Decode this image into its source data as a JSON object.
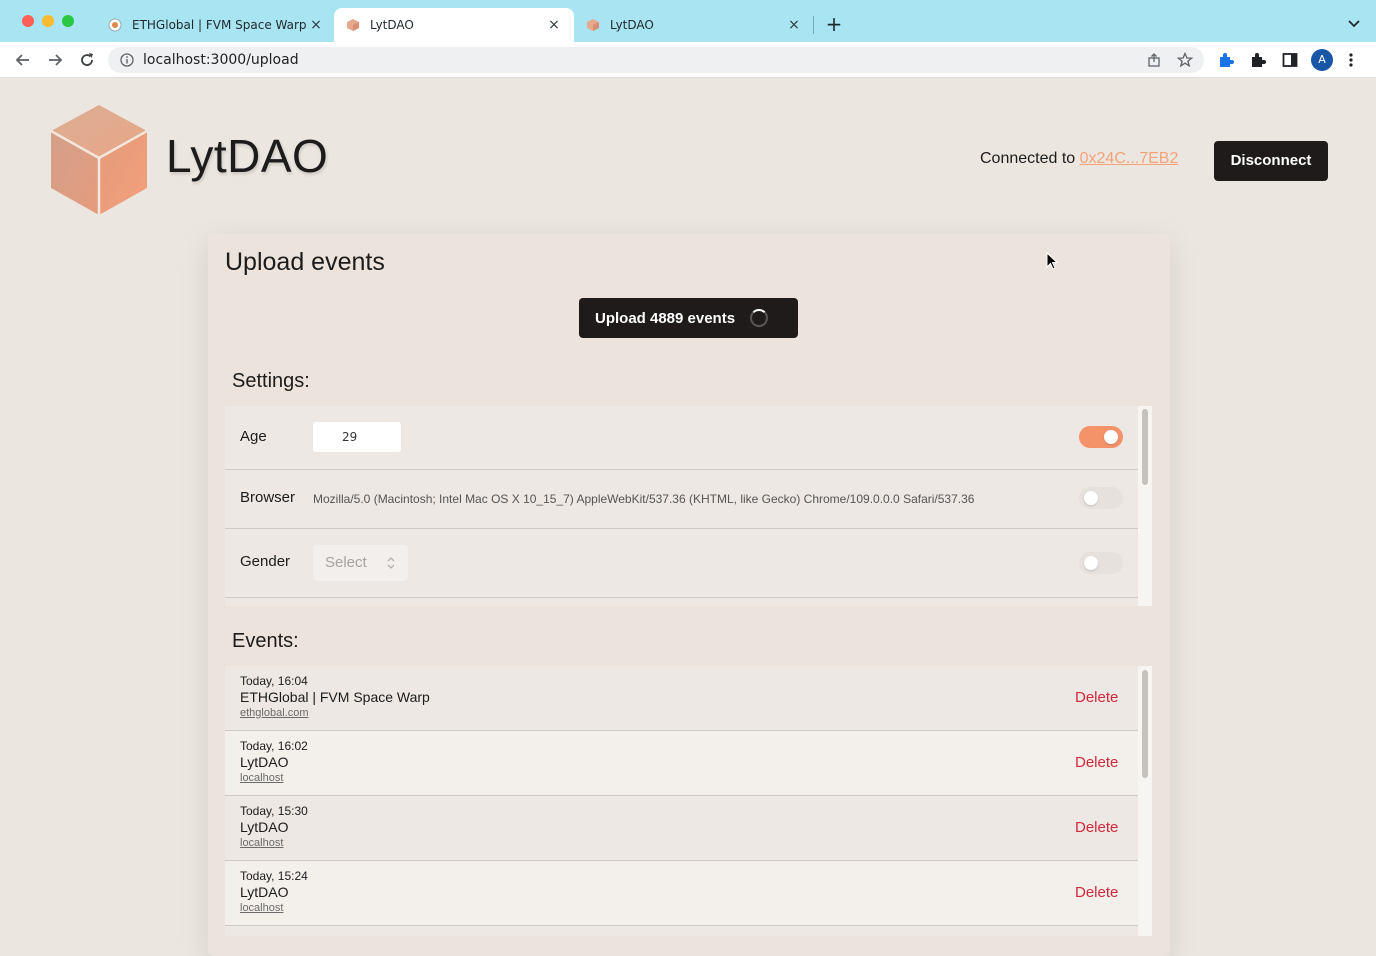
{
  "browser": {
    "tabs": [
      {
        "title": "ETHGlobal | FVM Space Warp",
        "close": "×",
        "favicon": "ethglobal-favicon"
      },
      {
        "title": "LytDAO",
        "close": "×",
        "favicon": "lytdao-favicon"
      },
      {
        "title": "LytDAO",
        "close": "×",
        "favicon": "lytdao-favicon"
      }
    ],
    "new_tab": "+",
    "url": "localhost:3000/upload",
    "profile_initial": "A",
    "colors": {
      "tabbar": "#a8e4f1",
      "profile": "#1a56a8"
    }
  },
  "header": {
    "brand": "LytDAO",
    "connected_label": "Connected to ",
    "address": "0x24C...7EB2",
    "disconnect_label": "Disconnect"
  },
  "upload": {
    "title": "Upload events",
    "button_label": "Upload 4889 events"
  },
  "settings": {
    "title": "Settings:",
    "age": {
      "label": "Age",
      "value": "29",
      "enabled": true
    },
    "browser": {
      "label": "Browser",
      "value": "Mozilla/5.0 (Macintosh; Intel Mac OS X 10_15_7) AppleWebKit/537.36 (KHTML, like Gecko) Chrome/109.0.0.0 Safari/537.36",
      "enabled": false
    },
    "gender": {
      "label": "Gender",
      "placeholder": "Select",
      "enabled": false
    }
  },
  "events": {
    "title": "Events:",
    "delete_label": "Delete",
    "items": [
      {
        "time": "Today, 16:04",
        "title": "ETHGlobal | FVM Space Warp",
        "link": "ethglobal.com"
      },
      {
        "time": "Today, 16:02",
        "title": "LytDAO",
        "link": "localhost"
      },
      {
        "time": "Today, 15:30",
        "title": "LytDAO",
        "link": "localhost"
      },
      {
        "time": "Today, 15:24",
        "title": "LytDAO",
        "link": "localhost"
      }
    ]
  },
  "colors": {
    "accent": "#f4926a",
    "link": "#f4a27a",
    "delete": "#d0283c",
    "button": "#1f1b1b"
  }
}
